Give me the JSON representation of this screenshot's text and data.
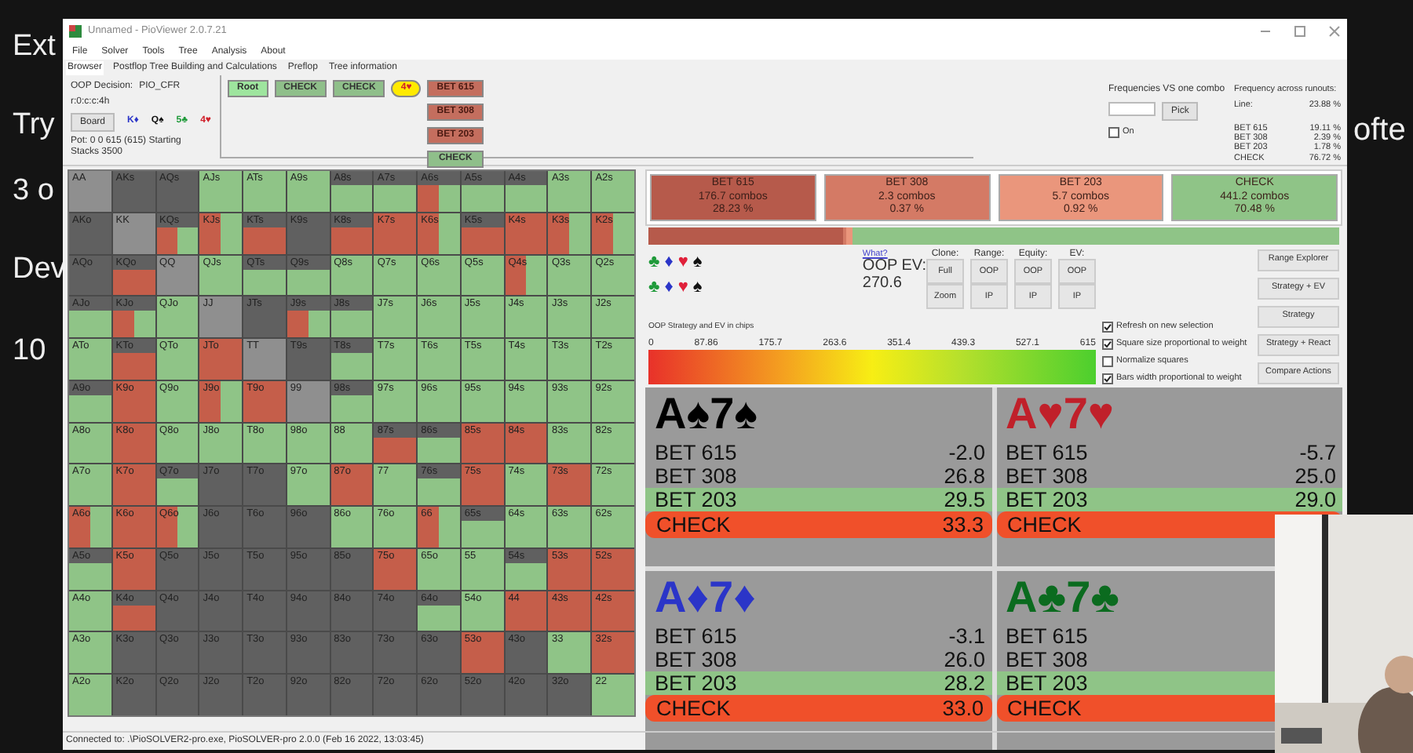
{
  "slide": {
    "lines": [
      "Ext",
      "Try",
      "3 o",
      "Dev",
      "10"
    ],
    "fragment": "ofte"
  },
  "window": {
    "title": "Unnamed - PioViewer 2.0.7.21"
  },
  "menu": [
    "File",
    "Solver",
    "Tools",
    "Tree",
    "Analysis",
    "About"
  ],
  "tabs": [
    {
      "label": "Browser",
      "selected": true
    },
    {
      "label": "Postflop Tree Building and Calculations",
      "selected": false
    },
    {
      "label": "Preflop",
      "selected": false
    },
    {
      "label": "Tree information",
      "selected": false
    }
  ],
  "decision": {
    "label": "OOP Decision:",
    "value": "PIO_CFR",
    "line": "r:0:c:c:4h",
    "board_button": "Board",
    "pot": "Pot: 0 0 615 (615) Starting Stacks 3500",
    "board": [
      {
        "card": "K♦",
        "color": "#2b35c8"
      },
      {
        "card": "Q♠",
        "color": "#111111"
      },
      {
        "card": "5♣",
        "color": "#1f9a3a"
      },
      {
        "card": "4♥",
        "color": "#d0202a"
      }
    ]
  },
  "tree": {
    "path": [
      {
        "label": "Root",
        "kind": "root"
      },
      {
        "label": "CHECK",
        "kind": "check"
      },
      {
        "label": "CHECK",
        "kind": "check"
      },
      {
        "label": "4♥",
        "kind": "card"
      }
    ],
    "options": [
      {
        "label": "BET 615",
        "kind": "bet"
      },
      {
        "label": "BET 308",
        "kind": "bet"
      },
      {
        "label": "BET 203",
        "kind": "bet"
      },
      {
        "label": "CHECK",
        "kind": "check"
      }
    ]
  },
  "combo": {
    "title": "Frequencies VS one combo",
    "button": "Pick",
    "toggle": "On",
    "on": false
  },
  "runouts": {
    "title": "Frequency across runouts:",
    "line": {
      "label": "Line:",
      "value": "23.88 %"
    },
    "rows": [
      {
        "label": "BET 615",
        "value": "19.11 %"
      },
      {
        "label": "BET 308",
        "value": "2.39 %"
      },
      {
        "label": "BET 203",
        "value": "1.78 %"
      },
      {
        "label": "CHECK",
        "value": "76.72 %"
      }
    ]
  },
  "grid": [
    [
      {
        "hand": "AA",
        "kind": "blocked"
      },
      {
        "hand": "AKs",
        "kind": "none"
      },
      {
        "hand": "AQs",
        "kind": "none"
      },
      {
        "hand": "AJs",
        "kind": "check",
        "partial": false
      },
      {
        "hand": "ATs",
        "kind": "check",
        "partial": false
      },
      {
        "hand": "A9s",
        "kind": "check",
        "partial": false
      },
      {
        "hand": "A8s",
        "kind": "check",
        "partial": true
      },
      {
        "hand": "A7s",
        "kind": "check",
        "partial": true
      },
      {
        "hand": "A6s",
        "kind": "mix",
        "partial": true
      },
      {
        "hand": "A5s",
        "kind": "check",
        "partial": true
      },
      {
        "hand": "A4s",
        "kind": "check",
        "partial": true
      },
      {
        "hand": "A3s",
        "kind": "check",
        "partial": false
      },
      {
        "hand": "A2s",
        "kind": "check",
        "partial": false
      }
    ],
    [
      {
        "hand": "AKo",
        "kind": "none"
      },
      {
        "hand": "KK",
        "kind": "blocked"
      },
      {
        "hand": "KQs",
        "kind": "mix",
        "partial": true
      },
      {
        "hand": "KJs",
        "kind": "mix",
        "partial": false
      },
      {
        "hand": "KTs",
        "kind": "bet",
        "partial": true
      },
      {
        "hand": "K9s",
        "kind": "none"
      },
      {
        "hand": "K8s",
        "kind": "bet",
        "partial": true
      },
      {
        "hand": "K7s",
        "kind": "bet",
        "partial": false
      },
      {
        "hand": "K6s",
        "kind": "mix",
        "partial": false
      },
      {
        "hand": "K5s",
        "kind": "bet",
        "partial": true
      },
      {
        "hand": "K4s",
        "kind": "bet",
        "partial": false
      },
      {
        "hand": "K3s",
        "kind": "mix",
        "partial": false
      },
      {
        "hand": "K2s",
        "kind": "mix",
        "partial": false
      }
    ],
    [
      {
        "hand": "AQo",
        "kind": "none"
      },
      {
        "hand": "KQo",
        "kind": "bet",
        "partial": true
      },
      {
        "hand": "QQ",
        "kind": "blocked"
      },
      {
        "hand": "QJs",
        "kind": "check",
        "partial": false
      },
      {
        "hand": "QTs",
        "kind": "check",
        "partial": true
      },
      {
        "hand": "Q9s",
        "kind": "check",
        "partial": true
      },
      {
        "hand": "Q8s",
        "kind": "check",
        "partial": false
      },
      {
        "hand": "Q7s",
        "kind": "check",
        "partial": false
      },
      {
        "hand": "Q6s",
        "kind": "check",
        "partial": false
      },
      {
        "hand": "Q5s",
        "kind": "check",
        "partial": false
      },
      {
        "hand": "Q4s",
        "kind": "mix",
        "partial": false
      },
      {
        "hand": "Q3s",
        "kind": "check",
        "partial": false
      },
      {
        "hand": "Q2s",
        "kind": "check",
        "partial": false
      }
    ],
    [
      {
        "hand": "AJo",
        "kind": "check",
        "partial": true
      },
      {
        "hand": "KJo",
        "kind": "mix",
        "partial": true
      },
      {
        "hand": "QJo",
        "kind": "check",
        "partial": false
      },
      {
        "hand": "JJ",
        "kind": "blocked"
      },
      {
        "hand": "JTs",
        "kind": "none"
      },
      {
        "hand": "J9s",
        "kind": "mix",
        "partial": true
      },
      {
        "hand": "J8s",
        "kind": "check",
        "partial": true
      },
      {
        "hand": "J7s",
        "kind": "check",
        "partial": false
      },
      {
        "hand": "J6s",
        "kind": "check",
        "partial": false
      },
      {
        "hand": "J5s",
        "kind": "check",
        "partial": false
      },
      {
        "hand": "J4s",
        "kind": "check",
        "partial": false
      },
      {
        "hand": "J3s",
        "kind": "check",
        "partial": false
      },
      {
        "hand": "J2s",
        "kind": "check",
        "partial": false
      }
    ],
    [
      {
        "hand": "ATo",
        "kind": "check",
        "partial": false
      },
      {
        "hand": "KTo",
        "kind": "bet",
        "partial": true
      },
      {
        "hand": "QTo",
        "kind": "check",
        "partial": false
      },
      {
        "hand": "JTo",
        "kind": "bet",
        "partial": false
      },
      {
        "hand": "TT",
        "kind": "blocked"
      },
      {
        "hand": "T9s",
        "kind": "none"
      },
      {
        "hand": "T8s",
        "kind": "check",
        "partial": true
      },
      {
        "hand": "T7s",
        "kind": "check",
        "partial": false
      },
      {
        "hand": "T6s",
        "kind": "check",
        "partial": false
      },
      {
        "hand": "T5s",
        "kind": "check",
        "partial": false
      },
      {
        "hand": "T4s",
        "kind": "check",
        "partial": false
      },
      {
        "hand": "T3s",
        "kind": "check",
        "partial": false
      },
      {
        "hand": "T2s",
        "kind": "check",
        "partial": false
      }
    ],
    [
      {
        "hand": "A9o",
        "kind": "check",
        "partial": true
      },
      {
        "hand": "K9o",
        "kind": "bet",
        "partial": false
      },
      {
        "hand": "Q9o",
        "kind": "check",
        "partial": false
      },
      {
        "hand": "J9o",
        "kind": "mix",
        "partial": false
      },
      {
        "hand": "T9o",
        "kind": "bet",
        "partial": false
      },
      {
        "hand": "99",
        "kind": "blocked"
      },
      {
        "hand": "98s",
        "kind": "check",
        "partial": true
      },
      {
        "hand": "97s",
        "kind": "check",
        "partial": false
      },
      {
        "hand": "96s",
        "kind": "check",
        "partial": false
      },
      {
        "hand": "95s",
        "kind": "check",
        "partial": false
      },
      {
        "hand": "94s",
        "kind": "check",
        "partial": false
      },
      {
        "hand": "93s",
        "kind": "check",
        "partial": false
      },
      {
        "hand": "92s",
        "kind": "check",
        "partial": false
      }
    ],
    [
      {
        "hand": "A8o",
        "kind": "check",
        "partial": false
      },
      {
        "hand": "K8o",
        "kind": "bet",
        "partial": false
      },
      {
        "hand": "Q8o",
        "kind": "check",
        "partial": false
      },
      {
        "hand": "J8o",
        "kind": "check",
        "partial": false
      },
      {
        "hand": "T8o",
        "kind": "check",
        "partial": false
      },
      {
        "hand": "98o",
        "kind": "check",
        "partial": false
      },
      {
        "hand": "88",
        "kind": "check",
        "partial": false
      },
      {
        "hand": "87s",
        "kind": "bet",
        "partial": true
      },
      {
        "hand": "86s",
        "kind": "check",
        "partial": true
      },
      {
        "hand": "85s",
        "kind": "bet",
        "partial": false
      },
      {
        "hand": "84s",
        "kind": "bet",
        "partial": false
      },
      {
        "hand": "83s",
        "kind": "check",
        "partial": false
      },
      {
        "hand": "82s",
        "kind": "check",
        "partial": false
      }
    ],
    [
      {
        "hand": "A7o",
        "kind": "check",
        "partial": false
      },
      {
        "hand": "K7o",
        "kind": "bet",
        "partial": false
      },
      {
        "hand": "Q7o",
        "kind": "check",
        "partial": true
      },
      {
        "hand": "J7o",
        "kind": "none"
      },
      {
        "hand": "T7o",
        "kind": "none"
      },
      {
        "hand": "97o",
        "kind": "check",
        "partial": false
      },
      {
        "hand": "87o",
        "kind": "bet",
        "partial": false
      },
      {
        "hand": "77",
        "kind": "check",
        "partial": false
      },
      {
        "hand": "76s",
        "kind": "check",
        "partial": true
      },
      {
        "hand": "75s",
        "kind": "bet",
        "partial": false
      },
      {
        "hand": "74s",
        "kind": "check",
        "partial": false
      },
      {
        "hand": "73s",
        "kind": "bet",
        "partial": false
      },
      {
        "hand": "72s",
        "kind": "check",
        "partial": false
      }
    ],
    [
      {
        "hand": "A6o",
        "kind": "mix",
        "partial": false
      },
      {
        "hand": "K6o",
        "kind": "bet",
        "partial": false
      },
      {
        "hand": "Q6o",
        "kind": "mix",
        "partial": false
      },
      {
        "hand": "J6o",
        "kind": "none"
      },
      {
        "hand": "T6o",
        "kind": "none"
      },
      {
        "hand": "96o",
        "kind": "none"
      },
      {
        "hand": "86o",
        "kind": "check",
        "partial": false
      },
      {
        "hand": "76o",
        "kind": "check",
        "partial": false
      },
      {
        "hand": "66",
        "kind": "mix",
        "partial": false
      },
      {
        "hand": "65s",
        "kind": "check",
        "partial": true
      },
      {
        "hand": "64s",
        "kind": "check",
        "partial": false
      },
      {
        "hand": "63s",
        "kind": "check",
        "partial": false
      },
      {
        "hand": "62s",
        "kind": "check",
        "partial": false
      }
    ],
    [
      {
        "hand": "A5o",
        "kind": "check",
        "partial": true
      },
      {
        "hand": "K5o",
        "kind": "bet",
        "partial": false
      },
      {
        "hand": "Q5o",
        "kind": "none"
      },
      {
        "hand": "J5o",
        "kind": "none"
      },
      {
        "hand": "T5o",
        "kind": "none"
      },
      {
        "hand": "95o",
        "kind": "none"
      },
      {
        "hand": "85o",
        "kind": "none"
      },
      {
        "hand": "75o",
        "kind": "bet",
        "partial": false
      },
      {
        "hand": "65o",
        "kind": "check",
        "partial": false
      },
      {
        "hand": "55",
        "kind": "check",
        "partial": false
      },
      {
        "hand": "54s",
        "kind": "check",
        "partial": true
      },
      {
        "hand": "53s",
        "kind": "bet",
        "partial": false
      },
      {
        "hand": "52s",
        "kind": "bet",
        "partial": false
      }
    ],
    [
      {
        "hand": "A4o",
        "kind": "check",
        "partial": false
      },
      {
        "hand": "K4o",
        "kind": "bet",
        "partial": true
      },
      {
        "hand": "Q4o",
        "kind": "none"
      },
      {
        "hand": "J4o",
        "kind": "none"
      },
      {
        "hand": "T4o",
        "kind": "none"
      },
      {
        "hand": "94o",
        "kind": "none"
      },
      {
        "hand": "84o",
        "kind": "none"
      },
      {
        "hand": "74o",
        "kind": "none"
      },
      {
        "hand": "64o",
        "kind": "check",
        "partial": true
      },
      {
        "hand": "54o",
        "kind": "check",
        "partial": false
      },
      {
        "hand": "44",
        "kind": "bet",
        "partial": false
      },
      {
        "hand": "43s",
        "kind": "bet",
        "partial": false
      },
      {
        "hand": "42s",
        "kind": "bet",
        "partial": false
      }
    ],
    [
      {
        "hand": "A3o",
        "kind": "check",
        "partial": false
      },
      {
        "hand": "K3o",
        "kind": "none"
      },
      {
        "hand": "Q3o",
        "kind": "none"
      },
      {
        "hand": "J3o",
        "kind": "none"
      },
      {
        "hand": "T3o",
        "kind": "none"
      },
      {
        "hand": "93o",
        "kind": "none"
      },
      {
        "hand": "83o",
        "kind": "none"
      },
      {
        "hand": "73o",
        "kind": "none"
      },
      {
        "hand": "63o",
        "kind": "none"
      },
      {
        "hand": "53o",
        "kind": "bet",
        "partial": false
      },
      {
        "hand": "43o",
        "kind": "none"
      },
      {
        "hand": "33",
        "kind": "check",
        "partial": false
      },
      {
        "hand": "32s",
        "kind": "bet",
        "partial": false
      }
    ],
    [
      {
        "hand": "A2o",
        "kind": "check",
        "partial": false
      },
      {
        "hand": "K2o",
        "kind": "none"
      },
      {
        "hand": "Q2o",
        "kind": "none"
      },
      {
        "hand": "J2o",
        "kind": "none"
      },
      {
        "hand": "T2o",
        "kind": "none"
      },
      {
        "hand": "92o",
        "kind": "none"
      },
      {
        "hand": "82o",
        "kind": "none"
      },
      {
        "hand": "72o",
        "kind": "none"
      },
      {
        "hand": "62o",
        "kind": "none"
      },
      {
        "hand": "52o",
        "kind": "none"
      },
      {
        "hand": "42o",
        "kind": "none"
      },
      {
        "hand": "32o",
        "kind": "none"
      },
      {
        "hand": "22",
        "kind": "check",
        "partial": false
      }
    ]
  ],
  "actions": [
    {
      "label": "BET 615",
      "combos": "176.7 combos",
      "percent": "28.23 %",
      "color": "#b65a4b",
      "level": 0.2823
    },
    {
      "label": "BET 308",
      "combos": "2.3 combos",
      "percent": "0.37 %",
      "color": "#d47a65",
      "level": 0.0037
    },
    {
      "label": "BET 203",
      "combos": "5.7 combos",
      "percent": "0.92 %",
      "color": "#ea967c",
      "level": 0.0092
    },
    {
      "label": "CHECK",
      "combos": "441.2 combos",
      "percent": "70.48 %",
      "color": "#8fc487",
      "level": 0.7048
    }
  ],
  "suit_rows": [
    [
      {
        "symbol": "♣",
        "color": "#1f9a3a"
      },
      {
        "symbol": "♦",
        "color": "#2b35c8"
      },
      {
        "symbol": "♥",
        "color": "#e0203a"
      },
      {
        "symbol": "♠",
        "color": "#111111"
      }
    ],
    [
      {
        "symbol": "♣",
        "color": "#1f9a3a"
      },
      {
        "symbol": "♦",
        "color": "#2b35c8"
      },
      {
        "symbol": "♥",
        "color": "#e0203a"
      },
      {
        "symbol": "♠",
        "color": "#111111"
      }
    ]
  ],
  "what_link": "What?",
  "ev": {
    "label": "OOP EV:",
    "value": "270.6"
  },
  "view_groups": [
    {
      "title": "Clone:",
      "buttons": [
        "Full",
        "Zoom"
      ]
    },
    {
      "title": "Range:",
      "buttons": [
        "OOP",
        "IP"
      ]
    },
    {
      "title": "Equity:",
      "buttons": [
        "OOP",
        "IP"
      ]
    },
    {
      "title": "EV:",
      "buttons": [
        "OOP",
        "IP"
      ]
    }
  ],
  "side_buttons": [
    "Range Explorer",
    "Strategy + EV",
    "Strategy",
    "Strategy + React",
    "Compare Actions"
  ],
  "options": [
    {
      "label": "Refresh on new selection",
      "checked": true
    },
    {
      "label": "Square size proportional to weight",
      "checked": true
    },
    {
      "label": "Normalize squares",
      "checked": false
    },
    {
      "label": "Bars width proportional to weight",
      "checked": true
    }
  ],
  "scale": {
    "title": "OOP Strategy and EV in chips",
    "ticks": [
      "0",
      "87.86",
      "175.7",
      "263.6",
      "351.4",
      "439.3",
      "527.1",
      "615"
    ]
  },
  "runout_cards": [
    {
      "cards": "A♠7♠",
      "color": "#000000",
      "rows": [
        {
          "label": "BET 615",
          "value": "-2.0",
          "kind": "plain"
        },
        {
          "label": "BET 308",
          "value": "26.8",
          "kind": "plain"
        },
        {
          "label": "BET 203",
          "value": "29.5",
          "kind": "good"
        },
        {
          "label": "CHECK",
          "value": "33.3",
          "kind": "alert"
        }
      ]
    },
    {
      "cards": "A♥7♥",
      "color": "#c0202a",
      "rows": [
        {
          "label": "BET 615",
          "value": "-5.7",
          "kind": "plain"
        },
        {
          "label": "BET 308",
          "value": "25.0",
          "kind": "plain"
        },
        {
          "label": "BET 203",
          "value": "29.0",
          "kind": "good"
        },
        {
          "label": "CHECK",
          "kind": "alert"
        }
      ]
    },
    {
      "cards": "A♦7♦",
      "color": "#2b35c8",
      "rows": [
        {
          "label": "BET 615",
          "value": "-3.1",
          "kind": "plain"
        },
        {
          "label": "BET 308",
          "value": "26.0",
          "kind": "plain"
        },
        {
          "label": "BET 203",
          "value": "28.2",
          "kind": "good"
        },
        {
          "label": "CHECK",
          "value": "33.0",
          "kind": "alert"
        }
      ]
    },
    {
      "cards": "A♣7♣",
      "color": "#0b6b1f",
      "rows": [
        {
          "label": "BET 615",
          "kind": "plain"
        },
        {
          "label": "BET 308",
          "kind": "plain"
        },
        {
          "label": "BET 203",
          "kind": "good"
        },
        {
          "label": "CHECK",
          "kind": "alert"
        }
      ]
    }
  ],
  "status": "Connected to: .\\PioSOLVER2-pro.exe, PioSOLVER-pro 2.0.0 (Feb 16 2022, 13:03:45)",
  "webcam": {
    "kind": "picture"
  }
}
